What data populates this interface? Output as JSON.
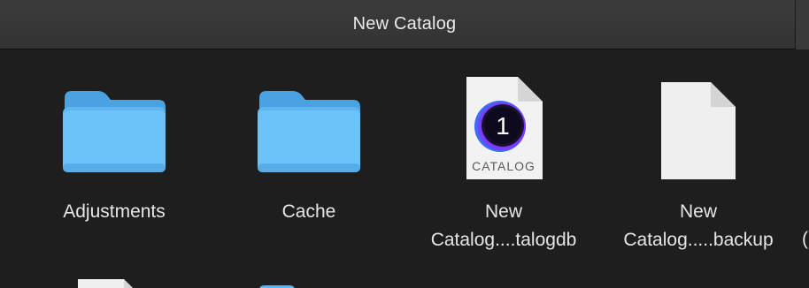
{
  "window": {
    "title": "New Catalog"
  },
  "items": [
    {
      "name": "Adjustments",
      "kind": "folder",
      "icon": "folder-icon"
    },
    {
      "name": "Cache",
      "kind": "folder",
      "icon": "folder-icon"
    },
    {
      "line1": "New",
      "line2": "Catalog....talogdb",
      "kind": "catalog-file",
      "icon": "capture-one-catalog-icon",
      "badge": "CATALOG",
      "mark": "1"
    },
    {
      "line1": "New",
      "line2": "Catalog.....backup",
      "kind": "document",
      "icon": "blank-document-icon"
    }
  ],
  "partial_label": "(",
  "colors": {
    "folder": "#5db6f0",
    "folder_front": "#6cc3fa",
    "background": "#1e1e1e",
    "titlebar": "#363636"
  }
}
